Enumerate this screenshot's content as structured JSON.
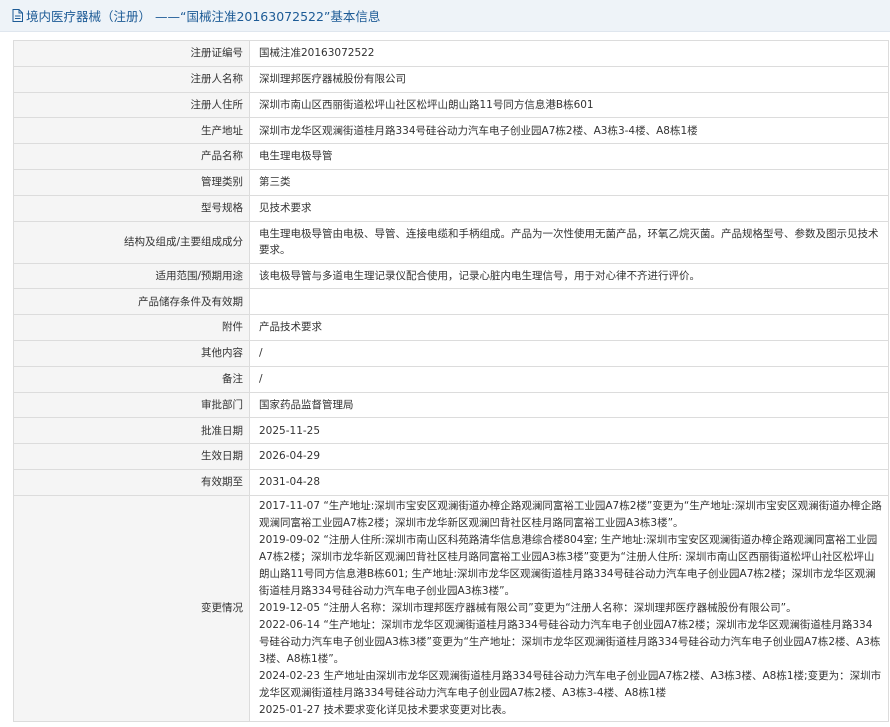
{
  "header": {
    "title": "境内医疗器械（注册） ——“国械注准20163072522”基本信息",
    "icon": "document-icon"
  },
  "rows": [
    {
      "label": "注册证编号",
      "value": "国械注准20163072522"
    },
    {
      "label": "注册人名称",
      "value": "深圳理邦医疗器械股份有限公司"
    },
    {
      "label": "注册人住所",
      "value": "深圳市南山区西丽街道松坪山社区松坪山朗山路11号同方信息港B栋601"
    },
    {
      "label": "生产地址",
      "value": "深圳市龙华区观澜街道桂月路334号硅谷动力汽车电子创业园A7栋2楼、A3栋3-4楼、A8栋1楼"
    },
    {
      "label": "产品名称",
      "value": "电生理电极导管"
    },
    {
      "label": "管理类别",
      "value": "第三类"
    },
    {
      "label": "型号规格",
      "value": "见技术要求"
    },
    {
      "label": "结构及组成/主要组成成分",
      "value": "电生理电极导管由电极、导管、连接电缆和手柄组成。产品为一次性使用无菌产品，环氧乙烷灭菌。产品规格型号、参数及图示见技术要求。"
    },
    {
      "label": "适用范围/预期用途",
      "value": "该电极导管与多道电生理记录仪配合使用，记录心脏内电生理信号，用于对心律不齐进行评价。"
    },
    {
      "label": "产品储存条件及有效期",
      "value": ""
    },
    {
      "label": "附件",
      "value": "产品技术要求"
    },
    {
      "label": "其他内容",
      "value": "/"
    },
    {
      "label": "备注",
      "value": "/"
    },
    {
      "label": "审批部门",
      "value": "国家药品监督管理局"
    },
    {
      "label": "批准日期",
      "value": "2025-11-25"
    },
    {
      "label": "生效日期",
      "value": "2026-04-29"
    },
    {
      "label": "有效期至",
      "value": "2031-04-28"
    }
  ],
  "history": {
    "label": "变更情况",
    "entries": [
      "2017-11-07 “生产地址:深圳市宝安区观澜街道办樟企路观澜同富裕工业园A7栋2楼”变更为“生产地址:深圳市宝安区观澜街道办樟企路观澜同富裕工业园A7栋2楼；深圳市龙华新区观澜凹背社区桂月路同富裕工业园A3栋3楼”。",
      "2019-09-02 “注册人住所:深圳市南山区科苑路清华信息港综合楼804室; 生产地址:深圳市宝安区观澜街道办樟企路观澜同富裕工业园A7栋2楼；深圳市龙华新区观澜凹背社区桂月路同富裕工业园A3栋3楼”变更为“注册人住所: 深圳市南山区西丽街道松坪山社区松坪山朗山路11号同方信息港B栋601; 生产地址:深圳市龙华区观澜街道桂月路334号硅谷动力汽车电子创业园A7栋2楼；深圳市龙华区观澜街道桂月路334号硅谷动力汽车电子创业园A3栋3楼”。",
      "2019-12-05 “注册人名称：深圳市理邦医疗器械有限公司”变更为“注册人名称：深圳理邦医疗器械股份有限公司”。",
      "2022-06-14 “生产地址：深圳市龙华区观澜街道桂月路334号硅谷动力汽车电子创业园A7栋2楼；深圳市龙华区观澜街道桂月路334号硅谷动力汽车电子创业园A3栋3楼”变更为“生产地址：深圳市龙华区观澜街道桂月路334号硅谷动力汽车电子创业园A7栋2楼、A3栋3楼、A8栋1楼”。",
      "2024-02-23 生产地址由深圳市龙华区观澜街道桂月路334号硅谷动力汽车电子创业园A7栋2楼、A3栋3楼、A8栋1楼;变更为：深圳市龙华区观澜街道桂月路334号硅谷动力汽车电子创业园A7栋2楼、A3栋3-4楼、A8栋1楼",
      "2025-01-27 技术要求变化详见技术要求变更对比表。"
    ]
  }
}
